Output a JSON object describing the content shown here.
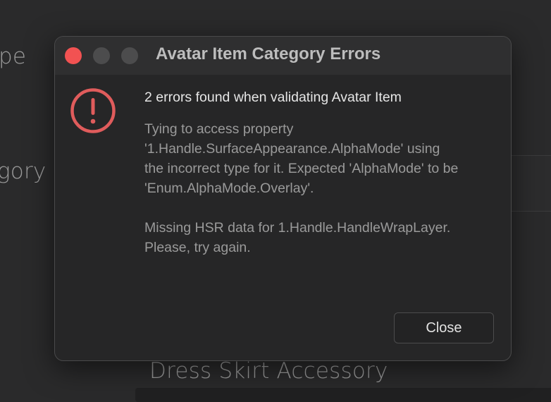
{
  "background": {
    "label_type": "pe",
    "label_category": "gory",
    "label_accessory": "Dress Skirt Accessory"
  },
  "dialog": {
    "title": "Avatar Item Category Errors",
    "heading": "2 errors found when validating Avatar Item",
    "error1_lines": [
      "Tying to access property",
      "'1.Handle.SurfaceAppearance.AlphaMode' using",
      "the incorrect type for it. Expected 'AlphaMode' to be",
      "'Enum.AlphaMode.Overlay'."
    ],
    "error2_lines": [
      "Missing HSR data for 1.Handle.HandleWrapLayer.",
      "Please, try again."
    ],
    "close_label": "Close",
    "icon": "error-exclamation-icon",
    "colors": {
      "error": "#e05c5c",
      "close_light": "#f25252"
    }
  }
}
